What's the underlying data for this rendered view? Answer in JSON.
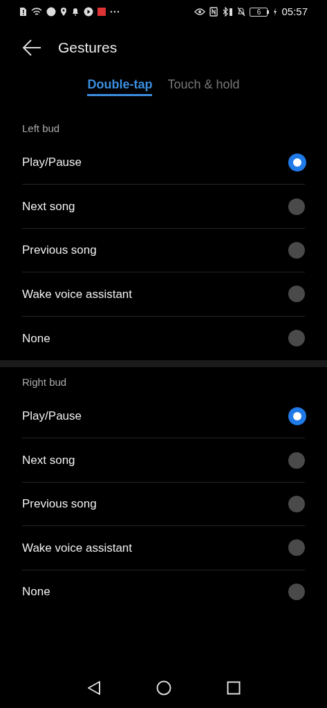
{
  "status_bar": {
    "battery": "6",
    "time": "05:57"
  },
  "header": {
    "title": "Gestures"
  },
  "tabs": [
    {
      "label": "Double-tap",
      "selected": true
    },
    {
      "label": "Touch & hold",
      "selected": false
    }
  ],
  "sections": [
    {
      "title": "Left bud",
      "options": [
        {
          "label": "Play/Pause",
          "selected": true
        },
        {
          "label": "Next song",
          "selected": false
        },
        {
          "label": "Previous song",
          "selected": false
        },
        {
          "label": "Wake voice assistant",
          "selected": false
        },
        {
          "label": "None",
          "selected": false
        }
      ]
    },
    {
      "title": "Right bud",
      "options": [
        {
          "label": "Play/Pause",
          "selected": true
        },
        {
          "label": "Next song",
          "selected": false
        },
        {
          "label": "Previous song",
          "selected": false
        },
        {
          "label": "Wake voice assistant",
          "selected": false
        },
        {
          "label": "None",
          "selected": false
        }
      ]
    }
  ]
}
